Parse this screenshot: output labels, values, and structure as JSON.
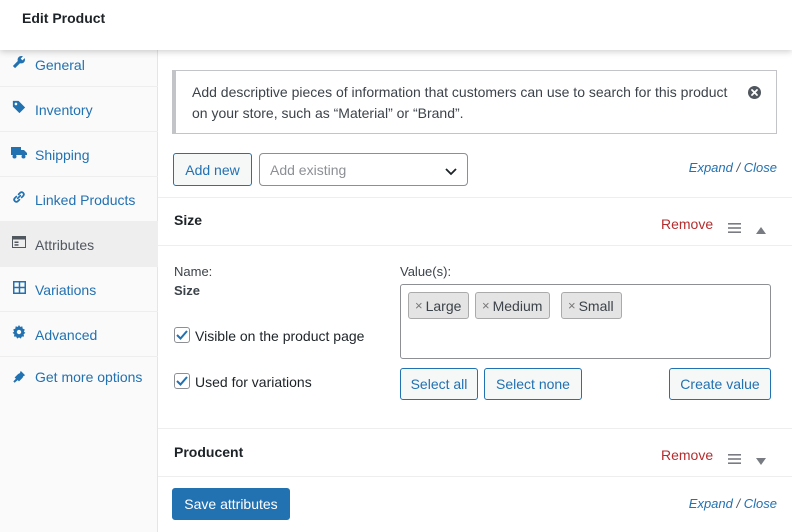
{
  "header": {
    "title": "Edit Product"
  },
  "sidebar": {
    "items": [
      {
        "label": "General",
        "icon": "wrench-icon"
      },
      {
        "label": "Inventory",
        "icon": "tag-icon"
      },
      {
        "label": "Shipping",
        "icon": "truck-icon"
      },
      {
        "label": "Linked Products",
        "icon": "link-icon"
      },
      {
        "label": "Attributes",
        "icon": "list-icon",
        "active": true
      },
      {
        "label": "Variations",
        "icon": "grid-icon"
      },
      {
        "label": "Advanced",
        "icon": "gear-icon"
      },
      {
        "label": "Get more options",
        "icon": "plugin-icon"
      }
    ]
  },
  "notice": {
    "text": "Add descriptive pieces of information that customers can use to search for this product on your store, such as “Material” or “Brand”."
  },
  "toolbar": {
    "add_new": "Add new",
    "add_existing_placeholder": "Add existing",
    "expand": "Expand",
    "separator": "/",
    "close": "Close"
  },
  "attributes": [
    {
      "name": "Size",
      "remove": "Remove",
      "expanded": true,
      "name_label": "Name:",
      "name_value": "Size",
      "values_label": "Value(s):",
      "values": [
        "Large",
        "Medium",
        "Small"
      ],
      "remove_chip_glyph": "×",
      "visible_label": "Visible on the product page",
      "visible_checked": true,
      "variations_label": "Used for variations",
      "variations_checked": true,
      "select_all": "Select all",
      "select_none": "Select none",
      "create_value": "Create value"
    },
    {
      "name": "Producent",
      "remove": "Remove",
      "expanded": false
    }
  ],
  "footer": {
    "save": "Save attributes",
    "expand": "Expand",
    "separator": "/",
    "close": "Close"
  },
  "colors": {
    "accent": "#2271b1",
    "danger": "#b32d2e",
    "text": "#1d2327"
  }
}
